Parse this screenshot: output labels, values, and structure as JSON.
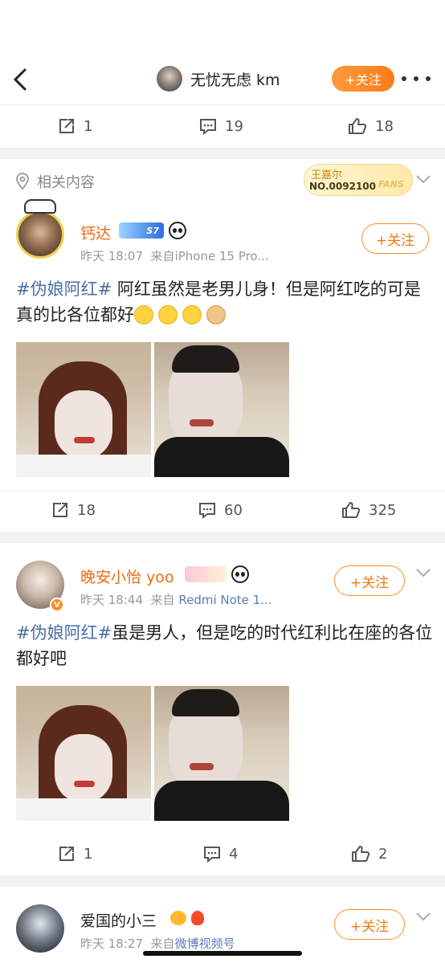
{
  "header": {
    "title": "无忧无虑 km",
    "follow_label": "+关注"
  },
  "top_post_actions": {
    "repost": "1",
    "comment": "19",
    "like": "18"
  },
  "related": {
    "label": "相关内容",
    "fans_badge": {
      "name": "王嘉尔",
      "number": "NO.0092100",
      "tag": "FANS"
    }
  },
  "posts": [
    {
      "username": "钙达",
      "vip_text": "S7",
      "time": "昨天 18:07",
      "source_prefix": "来自",
      "source": "iPhone 15 Pro...",
      "follow_label": "+关注",
      "hashtag": "#伪娘阿红#",
      "text": " 阿红虽然是老男儿身！但是阿红吃的可是真的比各位都好",
      "actions": {
        "repost": "18",
        "comment": "60",
        "like": "325"
      }
    },
    {
      "username": "晚安小怡 yoo",
      "v_badge": "V",
      "time": "昨天 18:44",
      "source_prefix": "来自",
      "source": "Redmi Note 1...",
      "follow_label": "+关注",
      "hashtag": "#伪娘阿红#",
      "text": "虽是男人，但是吃的时代红利比在座的各位都好吧",
      "actions": {
        "repost": "1",
        "comment": "4",
        "like": "2"
      }
    },
    {
      "username": "爱国的小三",
      "time": "昨天 18:27",
      "source_prefix": "来自",
      "source": "微博视频号",
      "follow_label": "+关注"
    }
  ],
  "colors": {
    "accent": "#ff8c1a",
    "hashtag": "#4a6fa5",
    "username": "#f06a0f"
  },
  "icons": [
    "back-icon",
    "more-icon",
    "repost-icon",
    "comment-icon",
    "like-icon",
    "location-icon",
    "chevron-down-icon"
  ]
}
